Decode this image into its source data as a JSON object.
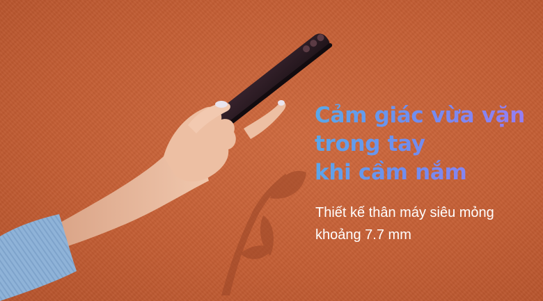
{
  "banner": {
    "headline": [
      "Cảm giác vừa vặn",
      "trong tay",
      "khi cầm nắm"
    ],
    "description": [
      "Thiết kế thân máy siêu mỏng",
      "khoảng 7.7 mm"
    ],
    "colors": {
      "background": "#c45e34",
      "headline_gradient_start": "#5aa8e8",
      "headline_gradient_end": "#9b7cf2",
      "description": "#ffffff",
      "sleeve": "#8fb3d8",
      "phone": "#2a1a22"
    }
  }
}
